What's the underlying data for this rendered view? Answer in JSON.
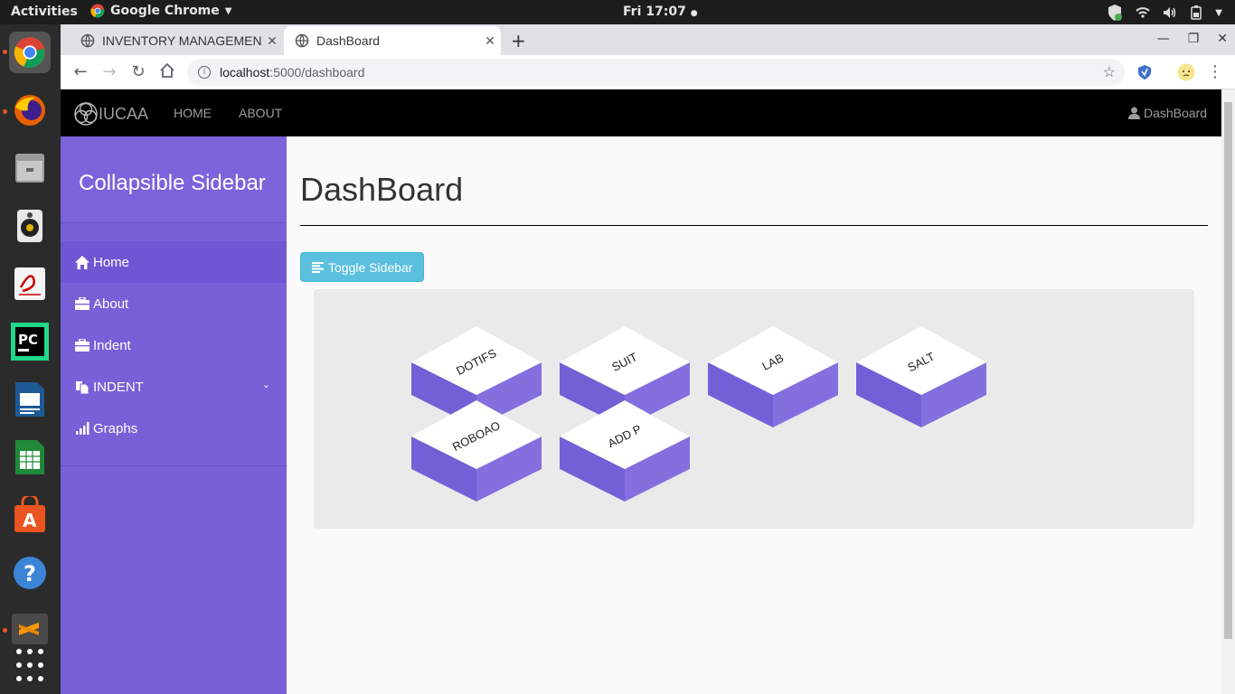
{
  "system": {
    "activities": "Activities",
    "app_name": "Google Chrome",
    "clock": "Fri 17:07"
  },
  "browser": {
    "tabs": [
      {
        "title": "INVENTORY MANAGEMENT",
        "active": false
      },
      {
        "title": "DashBoard",
        "active": true
      }
    ],
    "url_host": "localhost",
    "url_path": ":5000/dashboard"
  },
  "navbar": {
    "brand": "IUCAA",
    "links": [
      "HOME",
      "ABOUT"
    ],
    "user_link": "DashBoard"
  },
  "sidebar": {
    "title": "Collapsible Sidebar",
    "items": [
      {
        "label": "Home",
        "icon": "home-icon"
      },
      {
        "label": "About",
        "icon": "briefcase-icon"
      },
      {
        "label": "Indent",
        "icon": "briefcase-icon"
      },
      {
        "label": "INDENT",
        "icon": "copy-icon",
        "dropdown": true
      },
      {
        "label": "Graphs",
        "icon": "signal-icon"
      }
    ]
  },
  "main": {
    "heading": "DashBoard",
    "toggle_label": "Toggle Sidebar",
    "tiles": [
      "DOTIFS",
      "SUIT",
      "LAB",
      "SALT",
      "ROBOAO",
      "ADD P"
    ]
  },
  "colors": {
    "sidebar": "#7860d8",
    "tile_side": "#7a62d9",
    "button": "#5bc0de"
  }
}
